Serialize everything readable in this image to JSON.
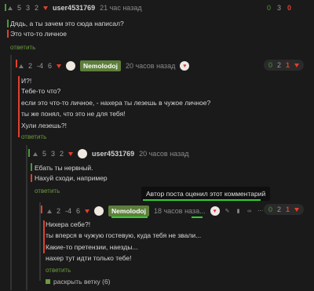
{
  "comments": [
    {
      "votes": [
        "5",
        "3",
        "2"
      ],
      "user": "user4531769",
      "time": "21 час назад",
      "score": [
        "0",
        "3",
        "0"
      ],
      "lines": [
        "Дядь, а ты зачем это сюда написал?",
        "Это что-то личное"
      ],
      "reply": "ответить"
    },
    {
      "votes": [
        "2",
        "-4",
        "6"
      ],
      "user": "Nemolodoj",
      "time": "20 часов назад",
      "score": [
        "0",
        "2",
        "1"
      ],
      "lines": [
        "И?!",
        "Тебе-то что?",
        "если это что-то личное, - нахера ты лезешь в чужое личное?",
        "ты же понял, что это не для тебя!",
        "Хули лезешь?!"
      ],
      "reply": "ответить"
    },
    {
      "votes": [
        "5",
        "3",
        "2"
      ],
      "user": "user4531769",
      "time": "20 часов назад",
      "lines": [
        "Ебать ты нервный.",
        "Нахуй сходи, например"
      ],
      "reply": "ответить"
    },
    {
      "votes": [
        "2",
        "-4",
        "6"
      ],
      "user": "Nemolodoj",
      "time": "18 часов наза...",
      "score": [
        "0",
        "2",
        "1"
      ],
      "lines": [
        "Нихера себе?!",
        "ты вперся в чужую гостевую, куда тебя не звали...",
        "Какие-то претензии, наезды...",
        "нахер тут идти только тебе!"
      ],
      "reply": "ответить",
      "expand": "раскрыть ветку (6)"
    }
  ],
  "tooltip": "Автор поста оценил этот комментарий",
  "colors": {
    "accent": "#5d7f3c",
    "down": "#e0402e",
    "underline": "#2fd02f"
  },
  "icons": [
    "up-arrow-icon",
    "down-arrow-icon",
    "avatar-icon",
    "heart-emoji-icon",
    "edit-icon",
    "bookmark-icon",
    "link-icon",
    "more-icon"
  ]
}
